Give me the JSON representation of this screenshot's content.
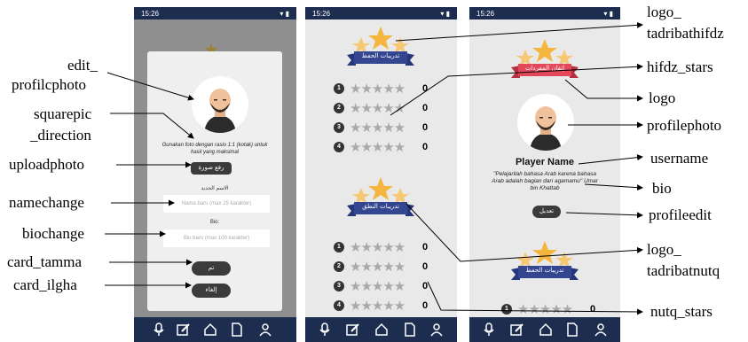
{
  "status_time": "15:26",
  "phone1": {
    "instruction": "Gunakan foto dengan rasio 1:1 (kotak) untuk hasil yang maksimal",
    "upload_button": "رفع صورة",
    "name_heading": "الاسم الجديد",
    "name_placeholder": "Nama baru (max 25 karakter)",
    "bio_heading": "Bio:",
    "bio_placeholder": "Bio baru (max 100 karakter)",
    "tamma_button": "تم",
    "ilgha_button": "إلغاء"
  },
  "phone2": {
    "hifdz_banner": "تدريبات الحفظ",
    "nutq_banner": "تدريبات النطق",
    "hifdz_rows": [
      {
        "n": "1",
        "score": "0"
      },
      {
        "n": "2",
        "score": "0"
      },
      {
        "n": "3",
        "score": "0"
      },
      {
        "n": "4",
        "score": "0"
      }
    ],
    "nutq_rows": [
      {
        "n": "1",
        "score": "0"
      },
      {
        "n": "2",
        "score": "0"
      },
      {
        "n": "3",
        "score": "0"
      },
      {
        "n": "4",
        "score": "0"
      }
    ]
  },
  "phone3": {
    "logo_banner": "إتقان المفردات",
    "username": "Player Name",
    "bio": "\"Pelajarilah bahasa Arab karena bahasa Arab adalah bagian dari agamamu\" Umar bin Khattab",
    "edit_button": "تعديل",
    "bottom_banner": "تدريبات الحفظ",
    "bottom_row_n": "1",
    "bottom_row_score": "0"
  },
  "labels": {
    "edit_profilephoto_1": "edit_",
    "edit_profilephoto_2": "profilcphoto",
    "squarepic_1": "squarepic",
    "squarepic_2": "_direction",
    "uploadphoto": "uploadphoto",
    "namechange": "namechange",
    "biochange": "biochange",
    "card_tamma": "card_tamma",
    "card_ilgha": "card_ilgha",
    "logo_tadribathifdz_1": "logo_",
    "logo_tadribathifdz_2": "tadribathifdz",
    "hifdz_stars": "hifdz_stars",
    "logo": "logo",
    "profilephoto": "profilephoto",
    "username": "username",
    "bio": "bio",
    "profileedit": "profileedit",
    "logo_tadribatnutq_1": "logo_",
    "logo_tadribatnutq_2": "tadribatnutq",
    "nutq_stars": "nutq_stars"
  },
  "colors": {
    "dark_navy": "#1d2d4f",
    "banner_blue": "#34468f",
    "banner_red": "#e2485a",
    "star_gold": "#f4b63e",
    "star_grey": "#a9a9a9"
  }
}
